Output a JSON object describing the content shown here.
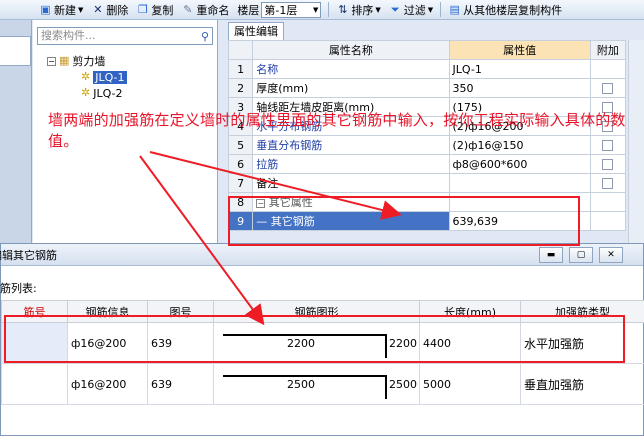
{
  "toolbar": {
    "new_label": "新建",
    "delete_label": "删除",
    "copy_label": "复制",
    "rename_label": "重命名",
    "floor_label": "楼层",
    "floor_value": "第-1层",
    "sort_label": "排序",
    "filter_label": "过滤",
    "copy_from_floor_label": "从其他楼层复制构件"
  },
  "tree": {
    "search_placeholder": "搜索构件...",
    "root_label": "剪力墙",
    "items": [
      "JLQ-1",
      "JLQ-2"
    ]
  },
  "property_panel": {
    "tab_label": "属性编辑",
    "columns": [
      "属性名称",
      "属性值",
      "附加"
    ],
    "rows": [
      {
        "index": "1",
        "name": "名称",
        "value": "JLQ-1"
      },
      {
        "index": "2",
        "name": "厚度(mm)",
        "value": "350"
      },
      {
        "index": "3",
        "name": "轴线距左墙皮距离(mm)",
        "value": "(175)"
      },
      {
        "index": "4",
        "name": "水平分布钢筋",
        "value": "(2)ф16@200"
      },
      {
        "index": "5",
        "name": "垂直分布钢筋",
        "value": "(2)ф16@150"
      },
      {
        "index": "6",
        "name": "拉筋",
        "value": "ф8@600*600"
      },
      {
        "index": "7",
        "name": "备注",
        "value": ""
      },
      {
        "index": "8",
        "name": "其它属性",
        "value": ""
      },
      {
        "index": "9",
        "name": "其它钢筋",
        "value": "639,639"
      }
    ]
  },
  "annotation": {
    "text": "墙两端的加强筋在定义墙时的属性里面的其它钢筋中输入，按你工程实际输入具体的数值。",
    "color": "#e8142a"
  },
  "dialog": {
    "title": "编辑其它钢筋",
    "list_label": "钢筋列表:",
    "columns": [
      "筋号",
      "钢筋信息",
      "图号",
      "钢筋图形",
      "长度(mm)",
      "加强筋类型"
    ],
    "rows": [
      {
        "bar_no": "",
        "bar_info": "ф16@200",
        "fig_no": "639",
        "shape_len": "2200",
        "shape_hook": "2200",
        "length": "4400",
        "type": "水平加强筋"
      },
      {
        "bar_no": "",
        "bar_info": "ф16@200",
        "fig_no": "639",
        "shape_len": "2500",
        "shape_hook": "2500",
        "length": "5000",
        "type": "垂直加强筋"
      }
    ]
  }
}
